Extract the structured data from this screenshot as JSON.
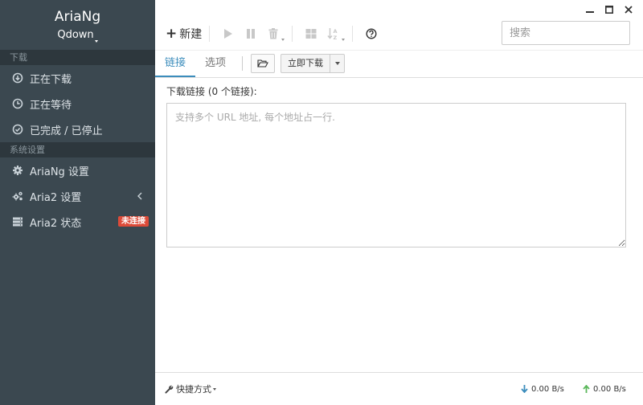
{
  "app": {
    "title": "AriaNg",
    "subtitle": "Qdown"
  },
  "sidebar": {
    "download_section": "下载",
    "downloads": [
      {
        "label": "正在下载",
        "icon": "download-circle-icon"
      },
      {
        "label": "正在等待",
        "icon": "clock-icon"
      },
      {
        "label": "已完成 / 已停止",
        "icon": "check-circle-icon"
      }
    ],
    "settings_section": "系统设置",
    "settings": [
      {
        "label": "AriaNg 设置",
        "icon": "gear-icon"
      },
      {
        "label": "Aria2 设置",
        "icon": "gears-icon"
      },
      {
        "label": "Aria2 状态",
        "icon": "server-icon",
        "badge": "未连接"
      }
    ]
  },
  "toolbar": {
    "new_label": "新建",
    "search_placeholder": "搜索"
  },
  "tabs": {
    "links": "链接",
    "options": "选项",
    "start_now": "立即下载"
  },
  "content": {
    "links_label": "下载链接 (0 个链接):",
    "links_placeholder": "支持多个 URL 地址, 每个地址占一行."
  },
  "footer": {
    "shortcut": "快捷方式",
    "download_speed": "0.00 B/s",
    "upload_speed": "0.00 B/s"
  },
  "colors": {
    "sidebar_bg": "#3b4850",
    "accent": "#3c8dbc",
    "badge": "#dd4b39",
    "download_arrow": "#3c8dbc",
    "upload_arrow": "#5cb85c"
  }
}
